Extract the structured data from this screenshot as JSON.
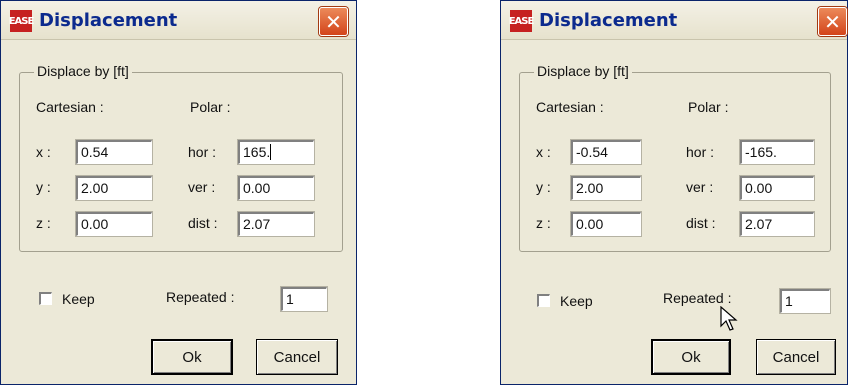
{
  "dialogs": [
    {
      "title": "Displacement",
      "app_icon": "EASE",
      "close_glyph": "✕",
      "group_label": "Displace by [ft]",
      "cartesian_label": "Cartesian :",
      "polar_label": "Polar :",
      "x_label": "x :",
      "y_label": "y :",
      "z_label": "z :",
      "hor_label": "hor :",
      "ver_label": "ver :",
      "dist_label": "dist :",
      "x_value": "0.54",
      "y_value": "2.00",
      "z_value": "0.00",
      "hor_value": "165.",
      "ver_value": "0.00",
      "dist_value": "2.07",
      "keep_label": "Keep",
      "keep_checked": false,
      "repeated_label": "Repeated :",
      "repeated_value": "1",
      "ok_label": "Ok",
      "cancel_label": "Cancel"
    },
    {
      "title": "Displacement",
      "app_icon": "EASE",
      "close_glyph": "✕",
      "group_label": "Displace by [ft]",
      "cartesian_label": "Cartesian :",
      "polar_label": "Polar :",
      "x_label": "x :",
      "y_label": "y :",
      "z_label": "z :",
      "hor_label": "hor :",
      "ver_label": "ver :",
      "dist_label": "dist :",
      "x_value": "-0.54",
      "y_value": "2.00",
      "z_value": "0.00",
      "hor_value": "-165.",
      "ver_value": "0.00",
      "dist_value": "2.07",
      "keep_label": "Keep",
      "keep_checked": false,
      "repeated_label": "Repeated :",
      "repeated_value": "1",
      "ok_label": "Ok",
      "cancel_label": "Cancel"
    }
  ],
  "icons": {
    "mouse_pointer": "arrow-cursor-icon"
  },
  "colors": {
    "title_text": "#0b2a8e",
    "close_button": "#d3441a",
    "dialog_bg": "#ece9d8",
    "app_icon_bg": "#c62020"
  }
}
